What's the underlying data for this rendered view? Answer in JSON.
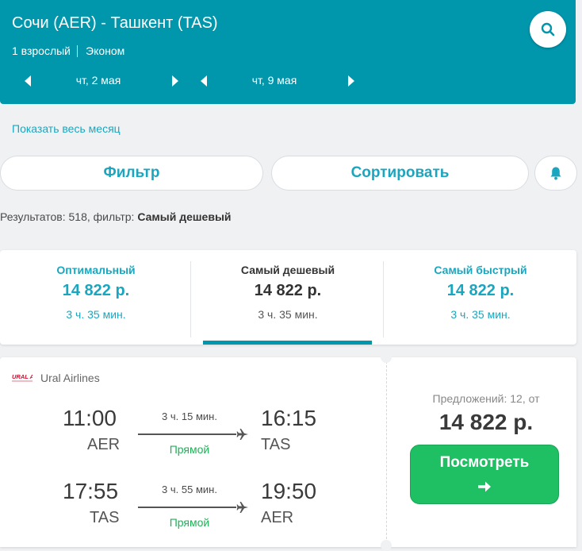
{
  "header": {
    "route": "Сочи (AER) - Ташкент (TAS)",
    "passengers": "1 взрослый",
    "cabin": "Эконом",
    "outbound_date": "чт, 2 мая",
    "return_date": "чт, 9 мая",
    "search_icon": "search-icon"
  },
  "show_month_link": "Показать весь месяц",
  "toolbar": {
    "filter_label": "Фильтр",
    "sort_label": "Сортировать",
    "bell_icon": "bell-icon"
  },
  "results": {
    "label": "Результатов: 518, фильтр:",
    "filter_value": "Самый дешевый"
  },
  "tabs": [
    {
      "name": "Оптимальный",
      "price": "14 822 р.",
      "duration": "3 ч. 35 мин."
    },
    {
      "name": "Самый дешевый",
      "price": "14 822 р.",
      "duration": "3 ч. 35 мин."
    },
    {
      "name": "Самый быстрый",
      "price": "14 822 р.",
      "duration": "3 ч. 35 мин."
    }
  ],
  "ticket": {
    "airline_logo_text": "URAL AIRLINES",
    "airline": "Ural Airlines",
    "segments": [
      {
        "dep_time": "11:00",
        "dep_code": "AER",
        "arr_time": "16:15",
        "arr_code": "TAS",
        "duration": "3 ч. 15 мин.",
        "type": "Прямой"
      },
      {
        "dep_time": "17:55",
        "dep_code": "TAS",
        "arr_time": "19:50",
        "arr_code": "AER",
        "duration": "3 ч. 55 мин.",
        "type": "Прямой"
      }
    ],
    "offers": "Предложений: 12, от",
    "price": "14 822 р.",
    "view_label": "Посмотреть",
    "arrow_icon": "arrow-right-icon"
  },
  "colors": {
    "header_bg": "#0097ad",
    "accent": "#1aa6bf",
    "green": "#1ec063",
    "direct": "#20b058"
  }
}
